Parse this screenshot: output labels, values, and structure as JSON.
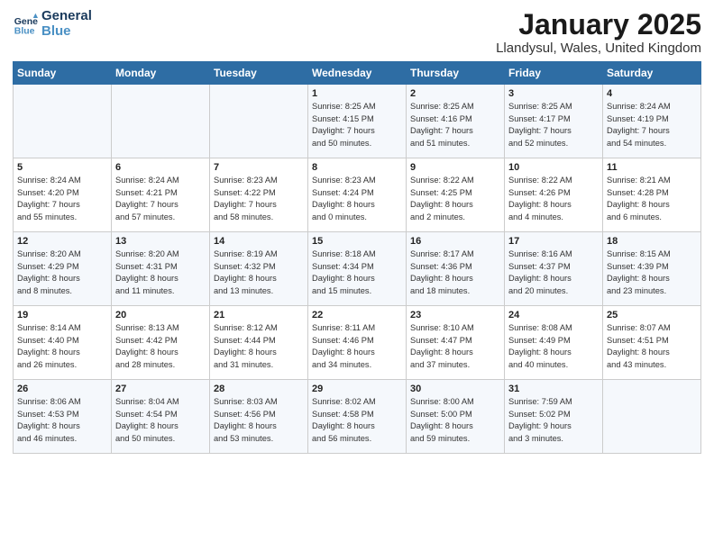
{
  "header": {
    "logo_line1": "General",
    "logo_line2": "Blue",
    "title": "January 2025",
    "subtitle": "Llandysul, Wales, United Kingdom"
  },
  "days_of_week": [
    "Sunday",
    "Monday",
    "Tuesday",
    "Wednesday",
    "Thursday",
    "Friday",
    "Saturday"
  ],
  "weeks": [
    [
      {
        "day": "",
        "text": ""
      },
      {
        "day": "",
        "text": ""
      },
      {
        "day": "",
        "text": ""
      },
      {
        "day": "1",
        "text": "Sunrise: 8:25 AM\nSunset: 4:15 PM\nDaylight: 7 hours\nand 50 minutes."
      },
      {
        "day": "2",
        "text": "Sunrise: 8:25 AM\nSunset: 4:16 PM\nDaylight: 7 hours\nand 51 minutes."
      },
      {
        "day": "3",
        "text": "Sunrise: 8:25 AM\nSunset: 4:17 PM\nDaylight: 7 hours\nand 52 minutes."
      },
      {
        "day": "4",
        "text": "Sunrise: 8:24 AM\nSunset: 4:19 PM\nDaylight: 7 hours\nand 54 minutes."
      }
    ],
    [
      {
        "day": "5",
        "text": "Sunrise: 8:24 AM\nSunset: 4:20 PM\nDaylight: 7 hours\nand 55 minutes."
      },
      {
        "day": "6",
        "text": "Sunrise: 8:24 AM\nSunset: 4:21 PM\nDaylight: 7 hours\nand 57 minutes."
      },
      {
        "day": "7",
        "text": "Sunrise: 8:23 AM\nSunset: 4:22 PM\nDaylight: 7 hours\nand 58 minutes."
      },
      {
        "day": "8",
        "text": "Sunrise: 8:23 AM\nSunset: 4:24 PM\nDaylight: 8 hours\nand 0 minutes."
      },
      {
        "day": "9",
        "text": "Sunrise: 8:22 AM\nSunset: 4:25 PM\nDaylight: 8 hours\nand 2 minutes."
      },
      {
        "day": "10",
        "text": "Sunrise: 8:22 AM\nSunset: 4:26 PM\nDaylight: 8 hours\nand 4 minutes."
      },
      {
        "day": "11",
        "text": "Sunrise: 8:21 AM\nSunset: 4:28 PM\nDaylight: 8 hours\nand 6 minutes."
      }
    ],
    [
      {
        "day": "12",
        "text": "Sunrise: 8:20 AM\nSunset: 4:29 PM\nDaylight: 8 hours\nand 8 minutes."
      },
      {
        "day": "13",
        "text": "Sunrise: 8:20 AM\nSunset: 4:31 PM\nDaylight: 8 hours\nand 11 minutes."
      },
      {
        "day": "14",
        "text": "Sunrise: 8:19 AM\nSunset: 4:32 PM\nDaylight: 8 hours\nand 13 minutes."
      },
      {
        "day": "15",
        "text": "Sunrise: 8:18 AM\nSunset: 4:34 PM\nDaylight: 8 hours\nand 15 minutes."
      },
      {
        "day": "16",
        "text": "Sunrise: 8:17 AM\nSunset: 4:36 PM\nDaylight: 8 hours\nand 18 minutes."
      },
      {
        "day": "17",
        "text": "Sunrise: 8:16 AM\nSunset: 4:37 PM\nDaylight: 8 hours\nand 20 minutes."
      },
      {
        "day": "18",
        "text": "Sunrise: 8:15 AM\nSunset: 4:39 PM\nDaylight: 8 hours\nand 23 minutes."
      }
    ],
    [
      {
        "day": "19",
        "text": "Sunrise: 8:14 AM\nSunset: 4:40 PM\nDaylight: 8 hours\nand 26 minutes."
      },
      {
        "day": "20",
        "text": "Sunrise: 8:13 AM\nSunset: 4:42 PM\nDaylight: 8 hours\nand 28 minutes."
      },
      {
        "day": "21",
        "text": "Sunrise: 8:12 AM\nSunset: 4:44 PM\nDaylight: 8 hours\nand 31 minutes."
      },
      {
        "day": "22",
        "text": "Sunrise: 8:11 AM\nSunset: 4:46 PM\nDaylight: 8 hours\nand 34 minutes."
      },
      {
        "day": "23",
        "text": "Sunrise: 8:10 AM\nSunset: 4:47 PM\nDaylight: 8 hours\nand 37 minutes."
      },
      {
        "day": "24",
        "text": "Sunrise: 8:08 AM\nSunset: 4:49 PM\nDaylight: 8 hours\nand 40 minutes."
      },
      {
        "day": "25",
        "text": "Sunrise: 8:07 AM\nSunset: 4:51 PM\nDaylight: 8 hours\nand 43 minutes."
      }
    ],
    [
      {
        "day": "26",
        "text": "Sunrise: 8:06 AM\nSunset: 4:53 PM\nDaylight: 8 hours\nand 46 minutes."
      },
      {
        "day": "27",
        "text": "Sunrise: 8:04 AM\nSunset: 4:54 PM\nDaylight: 8 hours\nand 50 minutes."
      },
      {
        "day": "28",
        "text": "Sunrise: 8:03 AM\nSunset: 4:56 PM\nDaylight: 8 hours\nand 53 minutes."
      },
      {
        "day": "29",
        "text": "Sunrise: 8:02 AM\nSunset: 4:58 PM\nDaylight: 8 hours\nand 56 minutes."
      },
      {
        "day": "30",
        "text": "Sunrise: 8:00 AM\nSunset: 5:00 PM\nDaylight: 8 hours\nand 59 minutes."
      },
      {
        "day": "31",
        "text": "Sunrise: 7:59 AM\nSunset: 5:02 PM\nDaylight: 9 hours\nand 3 minutes."
      },
      {
        "day": "",
        "text": ""
      }
    ]
  ]
}
